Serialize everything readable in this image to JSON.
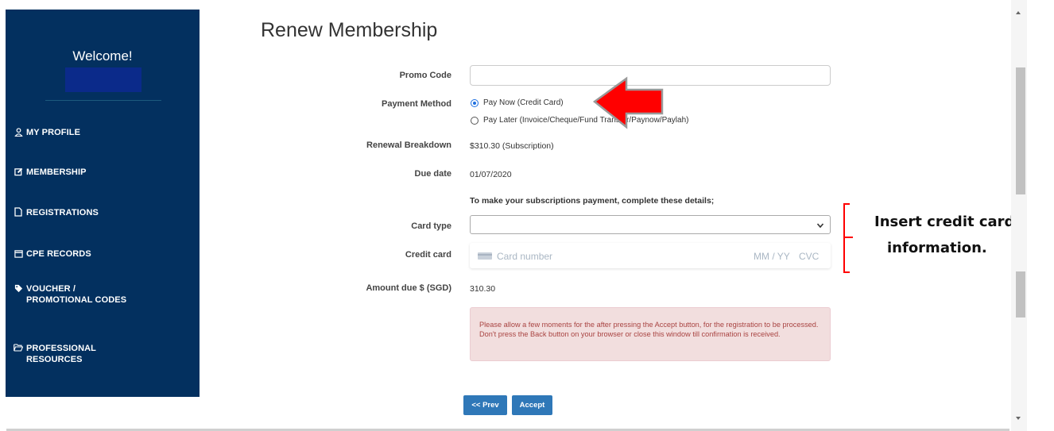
{
  "sidebar": {
    "welcome": "Welcome!",
    "items": [
      {
        "label": "MY PROFILE",
        "icon": "user-icon"
      },
      {
        "label": "MEMBERSHIP",
        "icon": "edit-icon"
      },
      {
        "label": "REGISTRATIONS",
        "icon": "file-icon"
      },
      {
        "label": "CPE RECORDS",
        "icon": "calendar-icon"
      },
      {
        "label": "VOUCHER /",
        "label2": "PROMOTIONAL CODES",
        "icon": "tag-icon"
      },
      {
        "label": "PROFESSIONAL",
        "label2": "RESOURCES",
        "icon": "folder-open-icon"
      }
    ],
    "colors": {
      "bg": "#03305f",
      "user_box": "#0b2a8a"
    }
  },
  "page": {
    "title": "Renew Membership"
  },
  "form": {
    "promo_code_label": "Promo Code",
    "promo_code_value": "",
    "payment_method_label": "Payment Method",
    "payment_options": [
      {
        "label": "Pay Now (Credit Card)",
        "checked": true
      },
      {
        "label": "Pay Later (Invoice/Cheque/Fund Transfer/Paynow/Paylah)",
        "checked": false
      }
    ],
    "renewal_breakdown_label": "Renewal Breakdown",
    "renewal_breakdown_value": "$310.30 (Subscription)",
    "due_date_label": "Due date",
    "due_date_value": "01/07/2020",
    "instruction": "To make your subscriptions payment, complete these details;",
    "card_type_label": "Card type",
    "card_type_value": "",
    "credit_card_label": "Credit card",
    "card_number_placeholder": "Card number",
    "card_expiry_placeholder": "MM / YY",
    "card_cvc_placeholder": "CVC",
    "amount_due_label": "Amount due $ (SGD)",
    "amount_due_value": "310.30",
    "alert_text": "Please allow a few moments for the after pressing the Accept button, for the registration to be processed. Don't press the Back button on your browser or close this window till confirmation is received."
  },
  "buttons": {
    "prev": "<< Prev",
    "accept": "Accept"
  },
  "annotation": {
    "line1": "Insert credit card",
    "line2": "information.",
    "color": "#ff0000"
  },
  "colors": {
    "accent": "#2f78b8",
    "alert_bg": "#f2dede",
    "alert_text": "#a94442",
    "radio": "#1e6fe0"
  }
}
